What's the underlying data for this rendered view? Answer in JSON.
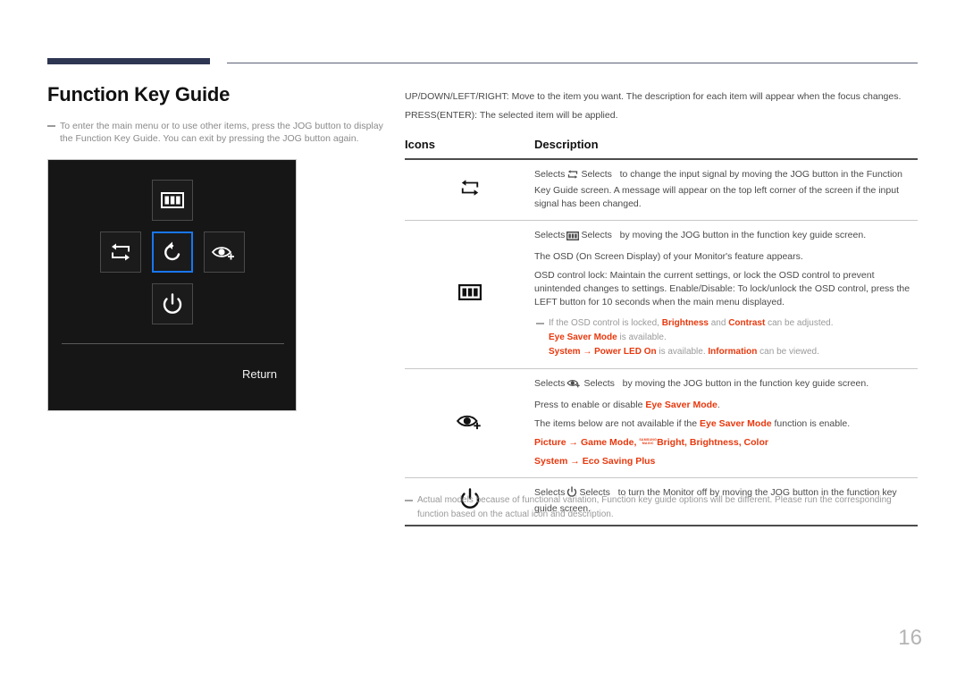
{
  "header": {
    "accent_color": "#2e3652",
    "rule_color": "#5b5f77"
  },
  "left": {
    "title": "Function Key Guide",
    "note_line1": "To enter the main menu or to use other items, press the JOG button to display",
    "note_line2": "the Function Key Guide. You can exit by pressing the JOG button again."
  },
  "monitor": {
    "keys": [
      {
        "pos": "up",
        "icon": "osd-menu-icon",
        "selected": false
      },
      {
        "pos": "left",
        "icon": "source-swap-icon",
        "selected": false
      },
      {
        "pos": "center",
        "icon": "return-arrow-icon",
        "selected": true
      },
      {
        "pos": "right",
        "icon": "eye-saver-icon",
        "selected": false
      },
      {
        "pos": "down",
        "icon": "power-icon",
        "selected": false
      }
    ],
    "return_label": "Return",
    "highlight_color": "#1976f0"
  },
  "intro": {
    "line1": "UP/DOWN/LEFT/RIGHT: Move to the item you want. The description for each item will appear when the focus changes.",
    "line2": "PRESS(ENTER): The selected item will be applied."
  },
  "table": {
    "headers": {
      "icons": "Icons",
      "description": "Description"
    },
    "rows": [
      {
        "icon": "source-swap-icon",
        "lines": [
          "Selects   to change the input signal by moving the JOG button in the Function Key Guide screen. A message will appear on the top left corner of the screen if the input signal has been changed."
        ]
      },
      {
        "icon": "osd-menu-icon",
        "lines": [
          "Selects   by moving the JOG button in the function key guide screen.",
          "The OSD (On Screen Display) of your Monitor's feature appears.",
          "OSD control lock: Maintain the current settings, or lock the OSD control to prevent unintended changes to settings. Enable/Disable: To lock/unlock the OSD control, press the LEFT button for 10 seconds when the main menu displayed."
        ],
        "sub": {
          "l1_a": "If the OSD control is locked, ",
          "l1_b": "Brightness",
          "l1_c": " and ",
          "l1_d": "Contrast",
          "l1_e": " can be adjusted.",
          "l2_a": "Eye Saver Mode",
          "l2_b": " is available.",
          "l3_a": "System",
          "l3_arrow": " → ",
          "l3_b": "Power LED On",
          "l3_c": " is available. ",
          "l3_d": "Information",
          "l3_e": " can be viewed."
        }
      },
      {
        "icon": "eye-saver-icon",
        "lines": [
          "Selects   by moving the JOG button in the function key guide screen.",
          "Press to enable or disable Eye Saver Mode.",
          "The items below are not available if the Eye Saver Mode function is enable."
        ],
        "menu": {
          "r1_picture": "Picture",
          "r1_arrow": " → ",
          "r1_game": "Game Mode",
          "r1_sep1": ", ",
          "r1_magic_top": "SAMSUNG",
          "r1_magic_bottom": "MAGIC",
          "r1_bright": "Bright",
          "r1_sep2": ", ",
          "r1_brightness": "Brightness",
          "r1_sep3": ", ",
          "r1_color": "Color",
          "r2_system": "System",
          "r2_arrow": " → ",
          "r2_eco": "Eco Saving Plus"
        },
        "emphasis": {
          "press_pre": "Press to enable or disable ",
          "press_bold": "Eye Saver Mode",
          "press_post": ".",
          "items_pre": "The items below are not available if the ",
          "items_bold": "Eye Saver Mode",
          "items_post": " function is enable."
        }
      },
      {
        "icon": "power-icon",
        "lines": [
          "Selects   to turn the Monitor off by moving the JOG button in the function key guide screen."
        ]
      }
    ]
  },
  "footnote": {
    "line1": "Actual models because of functional variation, Function key guide options will be different. Please run the corresponding",
    "line2": "function based on the actual icon and description."
  },
  "page_number": "16",
  "colors": {
    "red_accent": "#e8380d",
    "body_text": "#4a4a4a",
    "muted_text": "#9a9a9a"
  }
}
